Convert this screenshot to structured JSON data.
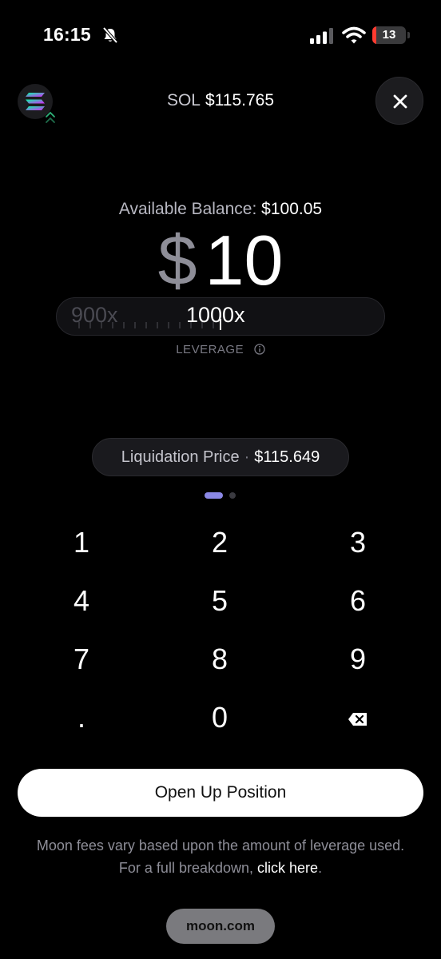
{
  "status": {
    "time": "16:15",
    "battery": "13",
    "battery_level": 0.13
  },
  "header": {
    "symbol": "SOL",
    "price": "$115.765"
  },
  "balance": {
    "label": "Available Balance:",
    "value": "$100.05"
  },
  "amount": {
    "currency": "$",
    "value": "10"
  },
  "leverage": {
    "previous": "900x",
    "current": "1000x",
    "label": "LEVERAGE"
  },
  "liquidation": {
    "label": "Liquidation Price",
    "separator": "·",
    "value": "$115.649"
  },
  "keypad": {
    "keys": [
      "1",
      "2",
      "3",
      "4",
      "5",
      "6",
      "7",
      "8",
      "9",
      ".",
      "0"
    ]
  },
  "cta": {
    "label": "Open Up Position"
  },
  "fee_note": {
    "text": "Moon fees vary based upon the amount of leverage used. For a full breakdown,",
    "link": "click here",
    "end": "."
  },
  "footer": {
    "domain": "moon.com"
  },
  "colors": {
    "accent": "#8b88e6",
    "battery_low": "#ff3b30"
  }
}
